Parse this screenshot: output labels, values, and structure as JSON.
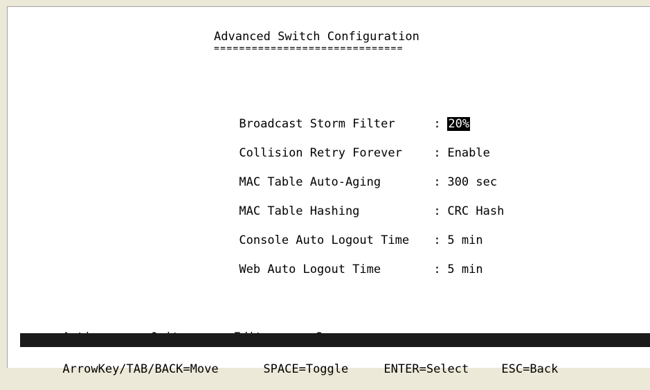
{
  "screen": {
    "title": "Advanced Switch Configuration",
    "title_underline": "=============================="
  },
  "settings": [
    {
      "label": "Broadcast Storm Filter",
      "value": "20%",
      "selected": true
    },
    {
      "label": "Collision Retry Forever",
      "value": "Enable",
      "selected": false
    },
    {
      "label": "MAC Table Auto-Aging",
      "value": "300 sec",
      "selected": false
    },
    {
      "label": "MAC Table Hashing",
      "value": "CRC Hash",
      "selected": false
    },
    {
      "label": "Console Auto Logout Time",
      "value": "5 min",
      "selected": false
    },
    {
      "label": "Web Auto Logout Time",
      "value": "5 min",
      "selected": false
    }
  ],
  "separator": ":",
  "actions": {
    "label": "Actions->",
    "quit": "<Quit>",
    "edit": "<Edit>",
    "save": "<Save>"
  },
  "help": {
    "move": "ArrowKey/TAB/BACK=Move",
    "toggle": "SPACE=Toggle",
    "select": "ENTER=Select",
    "back": "ESC=Back"
  },
  "colors": {
    "background": "#ffffff",
    "text": "#000000",
    "highlight": "#000000",
    "status_bar": "#1a1a1a"
  }
}
